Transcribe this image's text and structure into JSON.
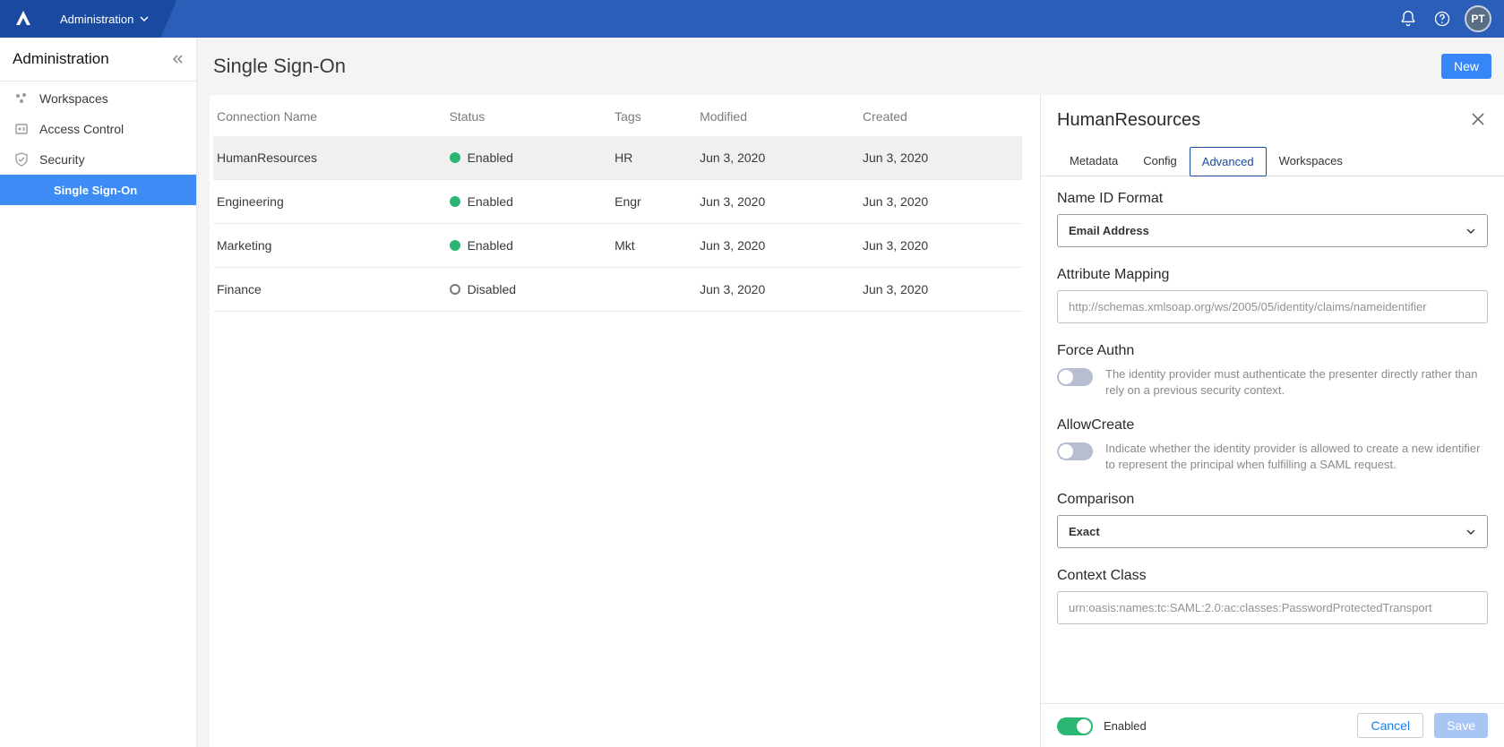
{
  "topbar": {
    "breadcrumb": "Administration",
    "avatar_initials": "PT"
  },
  "sidebar": {
    "title": "Administration",
    "items": [
      {
        "label": "Workspaces",
        "icon": "workspaces-icon"
      },
      {
        "label": "Access Control",
        "icon": "access-control-icon"
      },
      {
        "label": "Security",
        "icon": "shield-icon"
      }
    ],
    "sub_item_label": "Single Sign-On"
  },
  "page": {
    "title": "Single Sign-On",
    "new_button": "New"
  },
  "table": {
    "columns": [
      "Connection Name",
      "Status",
      "Tags",
      "Modified",
      "Created"
    ],
    "rows": [
      {
        "name": "HumanResources",
        "status": "Enabled",
        "tag": "HR",
        "modified": "Jun 3, 2020",
        "created": "Jun 3, 2020",
        "selected": true
      },
      {
        "name": "Engineering",
        "status": "Enabled",
        "tag": "Engr",
        "modified": "Jun 3, 2020",
        "created": "Jun 3, 2020",
        "selected": false
      },
      {
        "name": "Marketing",
        "status": "Enabled",
        "tag": "Mkt",
        "modified": "Jun 3, 2020",
        "created": "Jun 3, 2020",
        "selected": false
      },
      {
        "name": "Finance",
        "status": "Disabled",
        "tag": "",
        "modified": "Jun 3, 2020",
        "created": "Jun 3, 2020",
        "selected": false
      }
    ]
  },
  "detail": {
    "title": "HumanResources",
    "tabs": [
      "Metadata",
      "Config",
      "Advanced",
      "Workspaces"
    ],
    "active_tab": "Advanced",
    "fields": {
      "name_id_format": {
        "label": "Name ID Format",
        "value": "Email Address"
      },
      "attr_mapping": {
        "label": "Attribute Mapping",
        "placeholder": "http://schemas.xmlsoap.org/ws/2005/05/identity/claims/nameidentifier"
      },
      "force_authn": {
        "label": "Force Authn",
        "desc": "The identity provider must authenticate the presenter directly rather than rely on a previous security context.",
        "on": false
      },
      "allow_create": {
        "label": "AllowCreate",
        "desc": "Indicate whether the identity provider is allowed to create a new identifier to represent the principal when fulfilling a SAML request.",
        "on": false
      },
      "comparison": {
        "label": "Comparison",
        "value": "Exact"
      },
      "context_class": {
        "label": "Context Class",
        "placeholder": "urn:oasis:names:tc:SAML:2.0:ac:classes:PasswordProtectedTransport"
      }
    },
    "footer": {
      "enabled_label": "Enabled",
      "enabled_on": true,
      "cancel": "Cancel",
      "save": "Save"
    }
  }
}
